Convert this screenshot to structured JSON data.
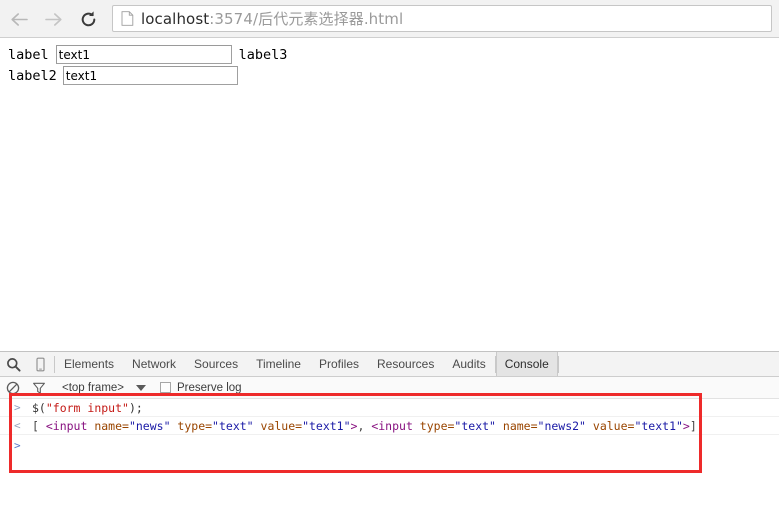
{
  "browser": {
    "back_icon": "arrow-left-icon",
    "forward_icon": "arrow-right-icon",
    "reload_icon": "reload-icon",
    "page_icon": "document-icon",
    "url_host": "localhost",
    "url_rest": ":3574/后代元素选择器.html",
    "url_full": "localhost:3574/后代元素选择器.html"
  },
  "page": {
    "rows": [
      {
        "label": "label",
        "input_value": "text1",
        "trailing_label": "label3"
      },
      {
        "label": "label2",
        "input_value": "text1",
        "trailing_label": ""
      }
    ]
  },
  "devtools": {
    "toolbar_icons": [
      {
        "name": "search-icon",
        "glyph": "⌕"
      },
      {
        "name": "device-toggle-icon",
        "glyph": "⎕"
      }
    ],
    "tabs": [
      {
        "label": "Elements",
        "active": false
      },
      {
        "label": "Network",
        "active": false
      },
      {
        "label": "Sources",
        "active": false
      },
      {
        "label": "Timeline",
        "active": false
      },
      {
        "label": "Profiles",
        "active": false
      },
      {
        "label": "Resources",
        "active": false
      },
      {
        "label": "Audits",
        "active": false
      },
      {
        "label": "Console",
        "active": true
      }
    ],
    "console_toolbar": {
      "clear_icon": "clear-console-icon",
      "filter_icon": "filter-icon",
      "frame_selector": "<top frame>",
      "caret_icon": "chevron-down-icon",
      "preserve_log_label": "Preserve log",
      "preserve_log_checked": false
    },
    "console_rows": [
      {
        "type": "input",
        "marker": ">",
        "segments": [
          {
            "cls": "c-plain",
            "text": "$("
          },
          {
            "cls": "c-str",
            "text": "\"form input\""
          },
          {
            "cls": "c-plain",
            "text": ");"
          }
        ]
      },
      {
        "type": "output",
        "marker": "<",
        "segments": [
          {
            "cls": "c-bracket",
            "text": "[ "
          },
          {
            "cls": "c-tag",
            "text": " <input"
          },
          {
            "cls": "c-attr",
            "text": " name="
          },
          {
            "cls": "c-val",
            "text": "\"news\""
          },
          {
            "cls": "c-attr",
            "text": " type="
          },
          {
            "cls": "c-val",
            "text": "\"text\""
          },
          {
            "cls": "c-attr",
            "text": " value="
          },
          {
            "cls": "c-val",
            "text": "\"text1\""
          },
          {
            "cls": "c-tag",
            "text": ">"
          },
          {
            "cls": "c-bracket",
            "text": ",   "
          },
          {
            "cls": "c-tag",
            "text": "<input"
          },
          {
            "cls": "c-attr",
            "text": " type="
          },
          {
            "cls": "c-val",
            "text": "\"text\""
          },
          {
            "cls": "c-attr",
            "text": " name="
          },
          {
            "cls": "c-val",
            "text": "\"news2\""
          },
          {
            "cls": "c-attr",
            "text": " value="
          },
          {
            "cls": "c-val",
            "text": "\"text1\""
          },
          {
            "cls": "c-tag",
            "text": ">"
          },
          {
            "cls": "c-bracket",
            "text": "]"
          }
        ]
      }
    ],
    "prompt_caret": ">"
  },
  "annotation": {
    "color": "#ee2a2a",
    "shape": "rectangle-highlight"
  }
}
